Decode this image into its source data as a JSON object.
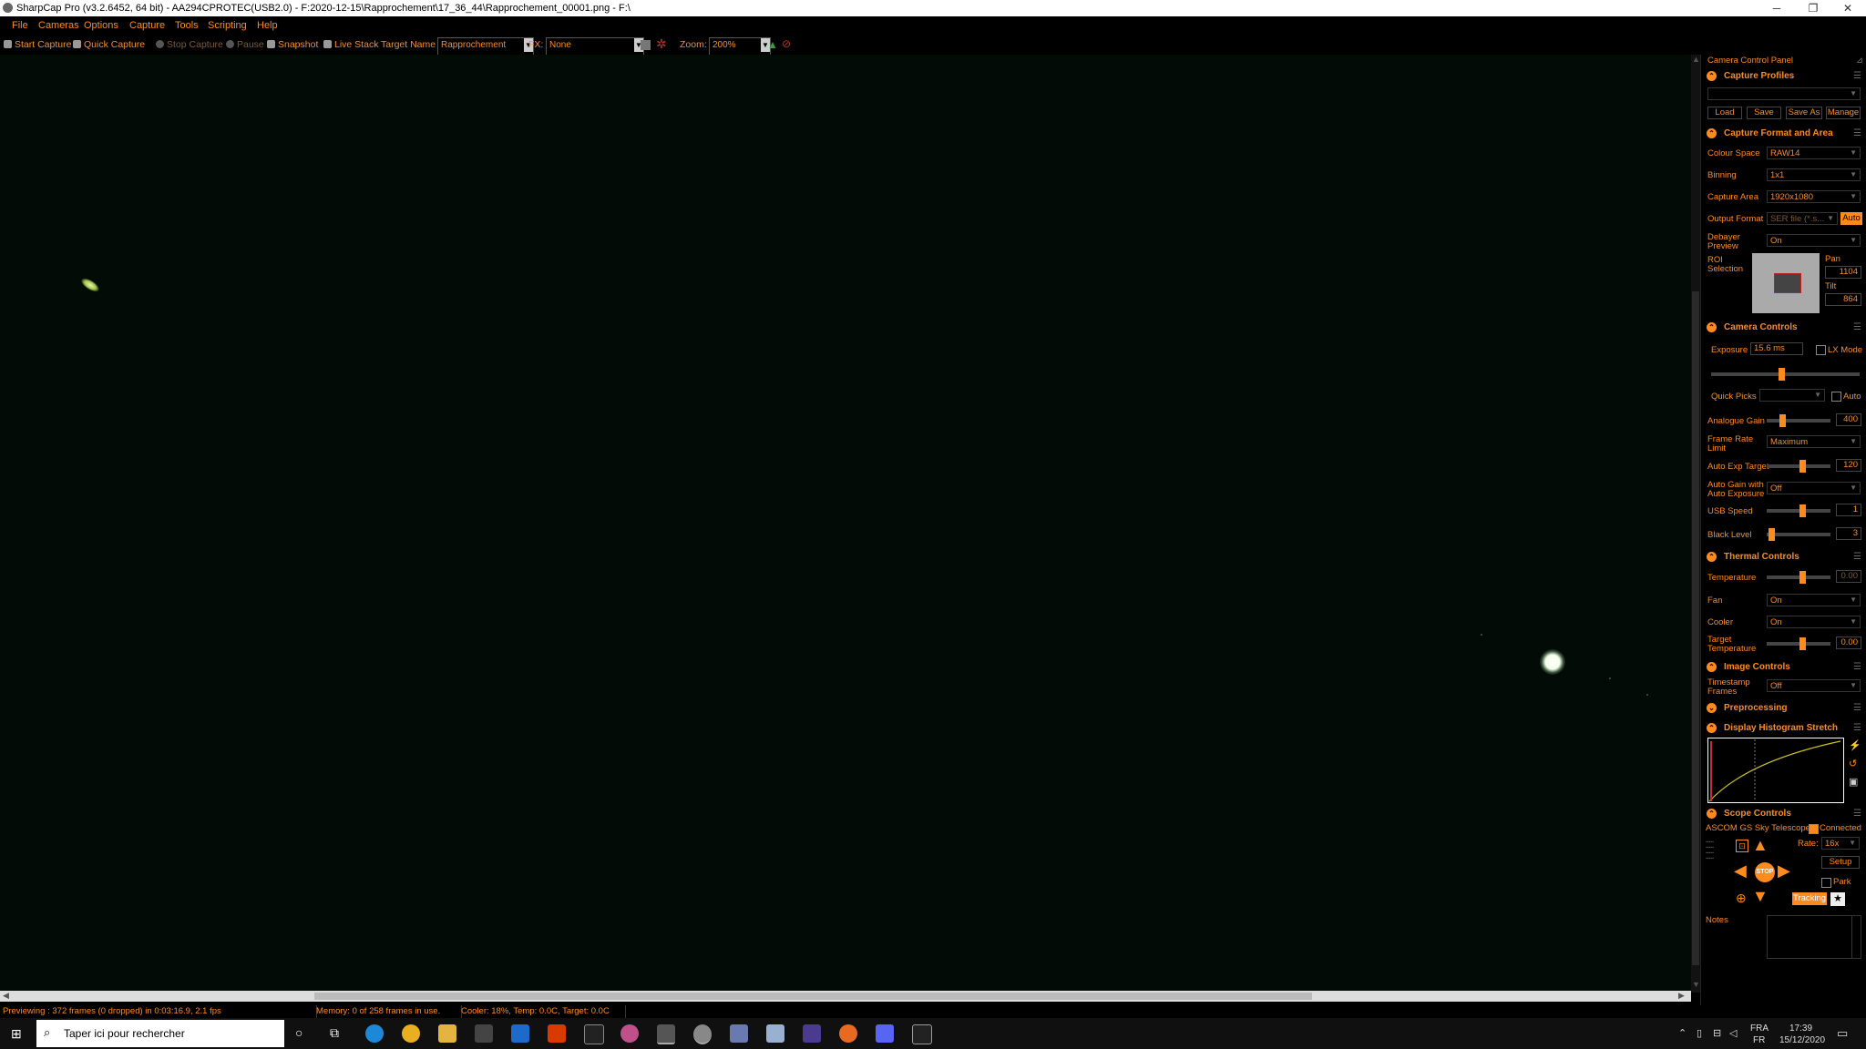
{
  "window": {
    "title": "SharpCap Pro (v3.2.6452, 64 bit) - AA294CPROTEC(USB2.0) - F:2020-12-15\\Rapprochement\\17_36_44\\Rapprochement_00001.png - F:\\",
    "min": "─",
    "max": "❐",
    "close": "✕"
  },
  "menu": [
    "File",
    "Cameras",
    "Options",
    "Capture",
    "Tools",
    "Scripting",
    "Help"
  ],
  "toolbar": {
    "start_capture": "Start Capture",
    "quick_capture": "Quick Capture",
    "stop_capture": "Stop Capture",
    "pause": "Pause",
    "snapshot": "Snapshot",
    "live_stack": "Live Stack",
    "target_name_label": "Target Name :",
    "target_name_value": "Rapprochement",
    "fx_label": "FX:",
    "fx_value": "None",
    "zoom_label": "Zoom:",
    "zoom_value": "200%"
  },
  "status": {
    "previewing": "Previewing : 372 frames (0 dropped) in 0:03:16.9, 2.1 fps",
    "memory": "Memory: 0 of 258 frames in use.",
    "cooler": "Cooler: 18%, Temp: 0.0C, Target: 0.0C"
  },
  "panel": {
    "title": "Camera Control Panel",
    "pin": "⊿",
    "capture_profiles": {
      "header": "Capture Profiles",
      "load": "Load",
      "save": "Save",
      "save_as": "Save As",
      "manage": "Manage"
    },
    "capture_format": {
      "header": "Capture Format and Area",
      "colour_space_label": "Colour Space",
      "colour_space": "RAW14",
      "binning_label": "Binning",
      "binning": "1x1",
      "capture_area_label": "Capture Area",
      "capture_area": "1920x1080",
      "output_format_label": "Output Format",
      "output_format": "SER file (*.s...",
      "output_auto": "Auto",
      "debayer_label": "Debayer Preview",
      "debayer": "On",
      "roi_label": "ROI Selection",
      "pan_label": "Pan",
      "pan": "1104",
      "tilt_label": "Tilt",
      "tilt": "864"
    },
    "camera_controls": {
      "header": "Camera Controls",
      "exposure_label": "Exposure",
      "exposure": "15.6 ms",
      "lx_mode": "LX Mode",
      "quick_picks_label": "Quick Picks",
      "auto": "Auto",
      "analogue_gain_label": "Analogue Gain",
      "analogue_gain": "400",
      "frame_rate_label": "Frame Rate Limit",
      "frame_rate": "Maximum",
      "auto_exp_label": "Auto Exp Target",
      "auto_exp": "120",
      "auto_gain_label": "Auto Gain with Auto Exposure",
      "auto_gain": "Off",
      "usb_label": "USB Speed",
      "usb": "1",
      "black_label": "Black Level",
      "black": "3"
    },
    "thermal": {
      "header": "Thermal Controls",
      "temperature_label": "Temperature",
      "temperature": "0.00",
      "fan_label": "Fan",
      "fan": "On",
      "cooler_label": "Cooler",
      "cooler": "On",
      "target_temp_label": "Target Temperature",
      "target_temp": "0.00"
    },
    "image_controls": {
      "header": "Image Controls",
      "timestamp_label": "Timestamp Frames",
      "timestamp": "Off"
    },
    "preprocessing": {
      "header": "Preprocessing"
    },
    "histogram": {
      "header": "Display Histogram Stretch"
    },
    "scope": {
      "header": "Scope Controls",
      "name": "ASCOM GS Sky Telescope",
      "connected": "Connected",
      "rate_label": "Rate:",
      "rate": "16x",
      "setup": "Setup",
      "park": "Park",
      "stop": "STOP",
      "tracking": "Tracking"
    },
    "notes_label": "Notes"
  },
  "taskbar": {
    "search_placeholder": "Taper ici pour rechercher",
    "lang1": "FRA",
    "lang2": "FR",
    "time": "17:39",
    "date": "15/12/2020"
  },
  "colors": {
    "accent": "#ff8a1e",
    "preview_bg": "#020b05"
  }
}
